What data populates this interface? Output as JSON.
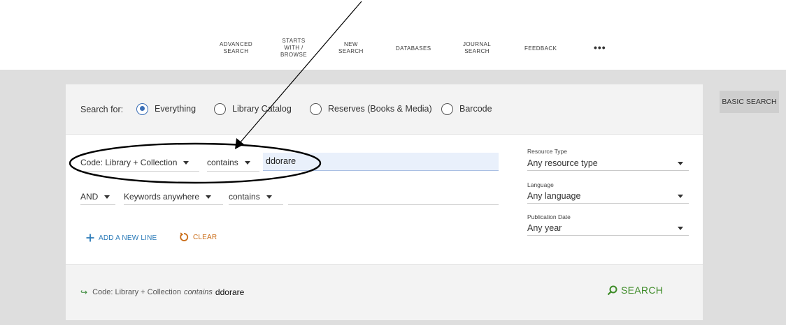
{
  "nav": {
    "items": [
      {
        "label": [
          "ADVANCED",
          "SEARCH"
        ]
      },
      {
        "label": [
          "STARTS",
          "WITH /",
          "BROWSE"
        ]
      },
      {
        "label": [
          "NEW",
          "SEARCH"
        ]
      },
      {
        "label": [
          "DATABASES"
        ]
      },
      {
        "label": [
          "JOURNAL",
          "SEARCH"
        ]
      },
      {
        "label": [
          "FEEDBACK"
        ]
      }
    ],
    "more": "•••"
  },
  "search_for": {
    "label": "Search for:",
    "options": [
      {
        "label": "Everything",
        "selected": true
      },
      {
        "label": "Library Catalog",
        "selected": false
      },
      {
        "label": "Reserves (Books & Media)",
        "selected": false
      },
      {
        "label": "Barcode",
        "selected": false
      }
    ]
  },
  "rows": [
    {
      "field": "Code: Library + Collection",
      "operator": "contains",
      "value": "ddorare"
    },
    {
      "boolean": "AND",
      "field": "Keywords anywhere",
      "operator": "contains",
      "value": ""
    }
  ],
  "actions": {
    "add_line": "ADD A NEW LINE",
    "clear": "CLEAR"
  },
  "filters": [
    {
      "label": "Resource Type",
      "value": "Any resource type"
    },
    {
      "label": "Language",
      "value": "Any language"
    },
    {
      "label": "Publication Date",
      "value": "Any year"
    }
  ],
  "summary": {
    "field": "Code: Library + Collection",
    "operator": "contains",
    "term": "ddorare",
    "search_label": "SEARCH"
  },
  "basic_search": "BASIC SEARCH",
  "colors": {
    "accent_blue": "#3b6fb6",
    "action_blue": "#2a7ab8",
    "clear_orange": "#c96a14",
    "search_green": "#3d8b27",
    "band_gray": "#dedede"
  }
}
